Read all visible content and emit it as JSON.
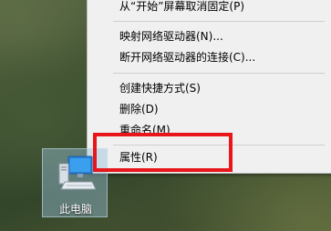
{
  "context_menu": {
    "items": [
      {
        "label": "从“开始”屏幕取消固定(P)"
      },
      {
        "label": "映射网络驱动器(N)..."
      },
      {
        "label": "断开网络驱动器的连接(C)..."
      },
      {
        "label": "创建快捷方式(S)"
      },
      {
        "label": "删除(D)"
      },
      {
        "label": "重命名(M)"
      },
      {
        "label": "属性(R)"
      }
    ]
  },
  "highlight_color": "#e8161a",
  "desktop_icon": {
    "label": "此电脑",
    "icon": "computer-icon"
  }
}
